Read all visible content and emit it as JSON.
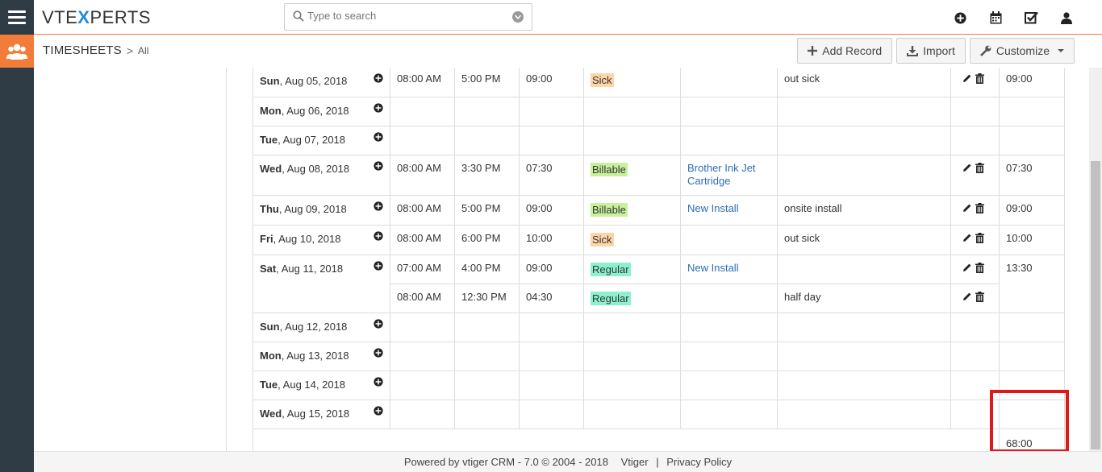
{
  "brand": {
    "pre": "VTE",
    "x": "X",
    "post": "PERTS"
  },
  "search": {
    "placeholder": "Type to search"
  },
  "module": {
    "name": "TIMESHEETS",
    "separator": ">",
    "view": "All"
  },
  "actions": {
    "add_record": "Add Record",
    "import": "Import",
    "customize": "Customize"
  },
  "days": [
    {
      "dow": "Sun",
      "date": ", Aug 05, 2018",
      "entries": [
        {
          "start": "08:00 AM",
          "end": "5:00 PM",
          "dur": "09:00",
          "type": "Sick",
          "related": "",
          "desc": "out sick"
        }
      ],
      "total": "09:00"
    },
    {
      "dow": "Mon",
      "date": ", Aug 06, 2018",
      "entries": [],
      "total": ""
    },
    {
      "dow": "Tue",
      "date": ", Aug 07, 2018",
      "entries": [],
      "total": ""
    },
    {
      "dow": "Wed",
      "date": ", Aug 08, 2018",
      "entries": [
        {
          "start": "08:00 AM",
          "end": "3:30 PM",
          "dur": "07:30",
          "type": "Billable",
          "related": "Brother Ink Jet Cartridge",
          "desc": ""
        }
      ],
      "total": "07:30"
    },
    {
      "dow": "Thu",
      "date": ", Aug 09, 2018",
      "entries": [
        {
          "start": "08:00 AM",
          "end": "5:00 PM",
          "dur": "09:00",
          "type": "Billable",
          "related": "New Install",
          "desc": "onsite install"
        }
      ],
      "total": "09:00"
    },
    {
      "dow": "Fri",
      "date": ", Aug 10, 2018",
      "entries": [
        {
          "start": "08:00 AM",
          "end": "6:00 PM",
          "dur": "10:00",
          "type": "Sick",
          "related": "",
          "desc": "out sick"
        }
      ],
      "total": "10:00"
    },
    {
      "dow": "Sat",
      "date": ", Aug 11, 2018",
      "entries": [
        {
          "start": "07:00 AM",
          "end": "4:00 PM",
          "dur": "09:00",
          "type": "Regular",
          "related": "New Install",
          "desc": ""
        },
        {
          "start": "08:00 AM",
          "end": "12:30 PM",
          "dur": "04:30",
          "type": "Regular",
          "related": "",
          "desc": "half day"
        }
      ],
      "total": "13:30"
    },
    {
      "dow": "Sun",
      "date": ", Aug 12, 2018",
      "entries": [],
      "total": ""
    },
    {
      "dow": "Mon",
      "date": ", Aug 13, 2018",
      "entries": [],
      "total": ""
    },
    {
      "dow": "Tue",
      "date": ", Aug 14, 2018",
      "entries": [],
      "total": ""
    },
    {
      "dow": "Wed",
      "date": ", Aug 15, 2018",
      "entries": [],
      "total": ""
    }
  ],
  "grand_total": "68:00",
  "colors": {
    "accent": "#f47c39",
    "rail": "#2f3b45",
    "highlight": "#e2171a",
    "billable": "#c9f09b",
    "sick": "#fcd6a9",
    "regular": "#8df1cf",
    "link": "#2f6db3"
  },
  "footer": {
    "powered": "Powered by vtiger CRM - 7.0",
    "copyright": "© 2004 - 2018",
    "vtiger": "Vtiger",
    "sep": "|",
    "privacy": "Privacy Policy"
  }
}
